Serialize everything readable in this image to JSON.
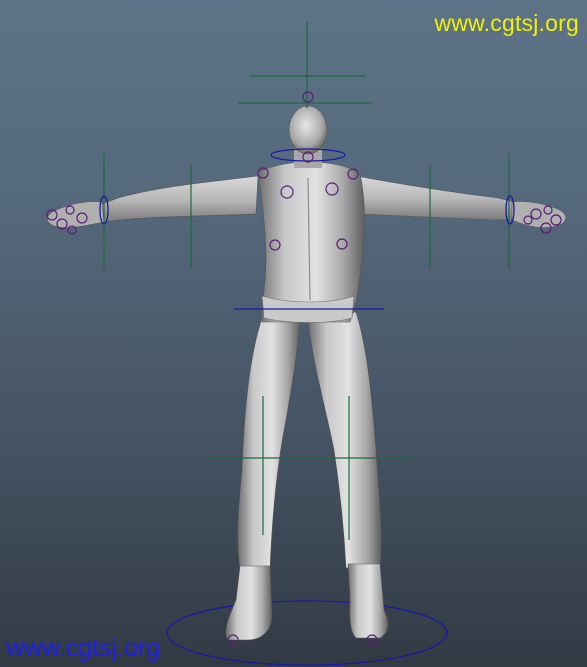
{
  "watermark": {
    "top": "www.cgtsj.org",
    "bottom": "www.cgtsj.org"
  },
  "colors": {
    "background_top": "#5e7387",
    "background_bottom": "#323a44",
    "watermark_top": "#f2f200",
    "watermark_bottom": "#1e1ef0",
    "ik_handle_green": "#1c6a3c",
    "control_blue": "#1a1aa0",
    "joint_purple": "#5a1e78",
    "model_gray": "#bfbfbf"
  },
  "scene": {
    "subject": "character-model",
    "rig_controls": true
  }
}
